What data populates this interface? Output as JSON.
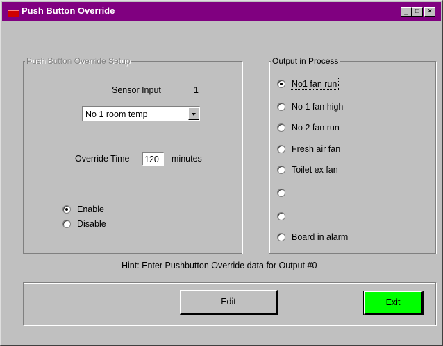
{
  "window": {
    "title": "Push Button Override",
    "controls": {
      "minimize": "_",
      "maximize": "□",
      "close": "×"
    }
  },
  "setup": {
    "group_label": "Push Button Override Setup",
    "sensor_input_label": "Sensor Input",
    "sensor_input_value": "1",
    "sensor_selected": "No 1 room temp",
    "override_time_label": "Override Time",
    "override_time_value": "120",
    "override_time_unit": "minutes",
    "mode_options": [
      {
        "label": "Enable",
        "checked": true
      },
      {
        "label": "Disable",
        "checked": false
      }
    ]
  },
  "output": {
    "group_label": "Output in Process",
    "items": [
      {
        "label": "No1 fan run",
        "checked": true
      },
      {
        "label": "No 1 fan high",
        "checked": false
      },
      {
        "label": "No 2 fan run",
        "checked": false
      },
      {
        "label": "Fresh air fan",
        "checked": false
      },
      {
        "label": "Toilet ex fan",
        "checked": false
      },
      {
        "label": "",
        "checked": false
      },
      {
        "label": "",
        "checked": false
      },
      {
        "label": "Board in alarm",
        "checked": false
      }
    ]
  },
  "hint": "Hint: Enter Pushbutton Override data for Output  #0",
  "buttons": {
    "edit": "Edit",
    "exit": "Exit"
  },
  "colors": {
    "titlebar": "#800080",
    "exit_button": "#00ff00",
    "face": "#c0c0c0"
  }
}
